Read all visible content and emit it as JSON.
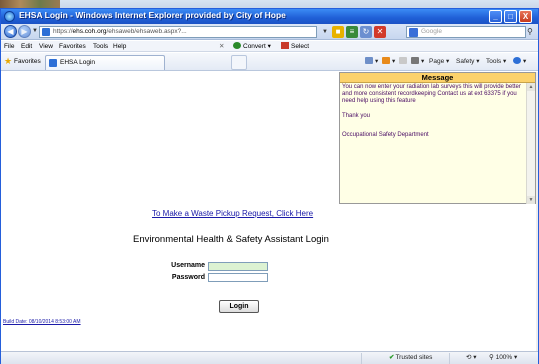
{
  "window": {
    "title": "EHSA Login - Windows Internet Explorer provided by City of Hope",
    "controls": [
      "_",
      "□",
      "X"
    ]
  },
  "address_bar": {
    "url_prefix": "https://",
    "url_host": "ehs.coh.org",
    "url_rest": "/ehsaweb/ehsaweb.aspx?...",
    "search_placeholder": "Google"
  },
  "menu": {
    "items": [
      "File",
      "Edit",
      "View",
      "Favorites",
      "Tools",
      "Help"
    ],
    "convert_label": "Convert",
    "select_label": "Select"
  },
  "favorites_bar": {
    "favorites_label": "Favorites",
    "tab_label": "EHSA Login",
    "commands": [
      "Page",
      "Safety",
      "Tools"
    ]
  },
  "message_panel": {
    "header": "Message",
    "paragraphs": [
      "You can now enter your radiation  lab surveys  this will provide better and more consistent recordkeeping Contact us at ext 63375 if you need help using this feature",
      "Thank you",
      "Occupational Safety Department"
    ]
  },
  "content": {
    "pickup_link": "To Make a Waste Pickup Request, Click Here",
    "login_title": "Environmental Health & Safety Assistant Login",
    "username_label": "Username",
    "password_label": "Password",
    "login_button": "Login",
    "build_date": "Build Date: 08/10/2014 8:53:00 AM"
  },
  "status_bar": {
    "zone": "Trusted sites",
    "zoom": "100%"
  },
  "colors": {
    "titlebar": "#1f5fd6",
    "message_header": "#fcd26b",
    "message_text": "#4a0c64",
    "link": "#1a1aa8",
    "username_fill": "#dcf2d2"
  }
}
